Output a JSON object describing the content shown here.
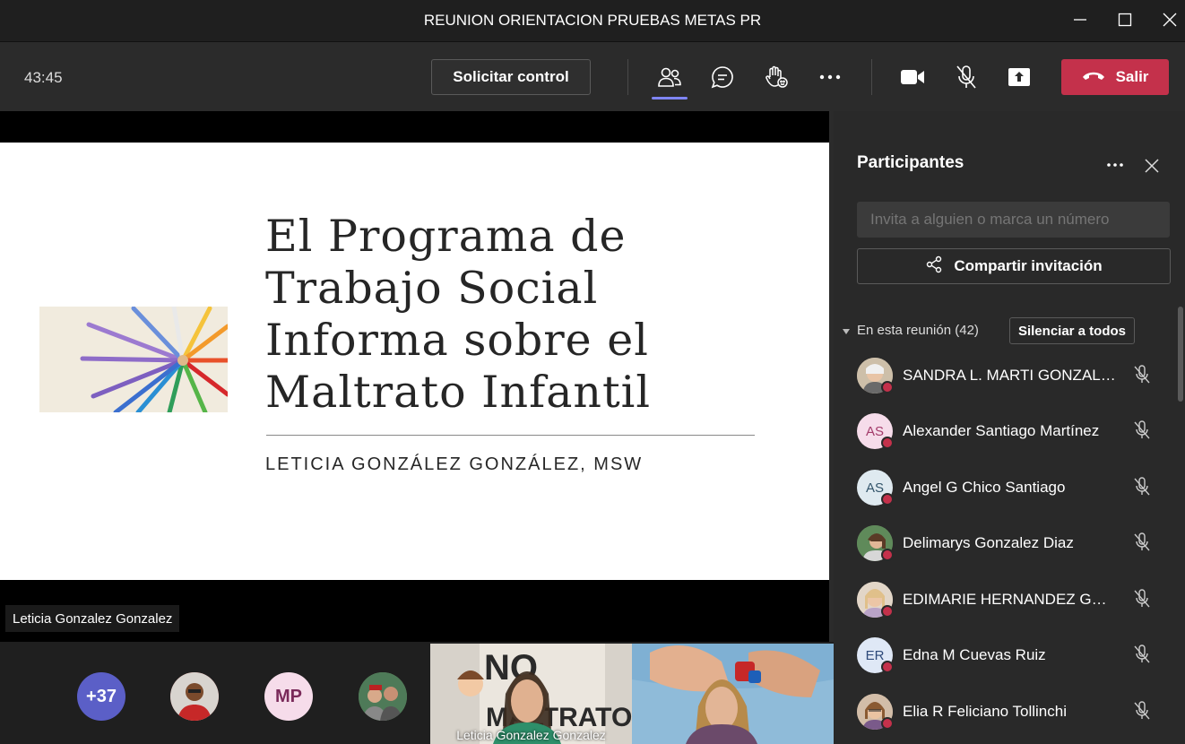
{
  "window": {
    "title": "REUNION ORIENTACION PRUEBAS METAS PR"
  },
  "toolbar": {
    "timer": "43:45",
    "request_control_label": "Solicitar control",
    "leave_label": "Salir",
    "icons": [
      "people-icon",
      "chat-icon",
      "raise-hand-icon",
      "more-icon",
      "camera-icon",
      "mic-off-icon",
      "share-tray-icon",
      "phone-hangup-icon"
    ]
  },
  "slide": {
    "title_lines": [
      "El Programa de",
      "Trabajo Social",
      "Informa sobre el",
      "Maltrato Infantil"
    ],
    "author": "LETICIA GONZÁLEZ GONZÁLEZ, MSW"
  },
  "stage": {
    "presenter_name": "Leticia Gonzalez Gonzalez"
  },
  "strip": {
    "overflow_count": "+37",
    "initials_avatar": "MP",
    "video_tiles": [
      {
        "name": "Leticia Gonzalez Gonzalez"
      },
      {
        "name": ""
      }
    ]
  },
  "panel": {
    "title": "Participantes",
    "invite_placeholder": "Invita a alguien o marca un número",
    "share_label": "Compartir invitación",
    "section_label": "En esta reunión (42)",
    "mute_all_label": "Silenciar a todos",
    "participants": [
      {
        "name": "SANDRA L. MARTI GONZALEZ",
        "initials": "",
        "photo": true
      },
      {
        "name": "Alexander Santiago Martínez",
        "initials": "AS",
        "photo": false
      },
      {
        "name": "Angel G Chico Santiago",
        "initials": "AS",
        "photo": false
      },
      {
        "name": "Delimarys Gonzalez Diaz",
        "initials": "",
        "photo": true
      },
      {
        "name": "EDIMARIE HERNANDEZ GON...",
        "initials": "",
        "photo": true
      },
      {
        "name": "Edna M Cuevas Ruiz",
        "initials": "ER",
        "photo": false
      },
      {
        "name": "Elia R Feliciano Tollinchi",
        "initials": "",
        "photo": true
      }
    ]
  },
  "colors": {
    "leave": "#c4314b",
    "accent": "#7f85f5",
    "status_dot": "#c4314b"
  }
}
